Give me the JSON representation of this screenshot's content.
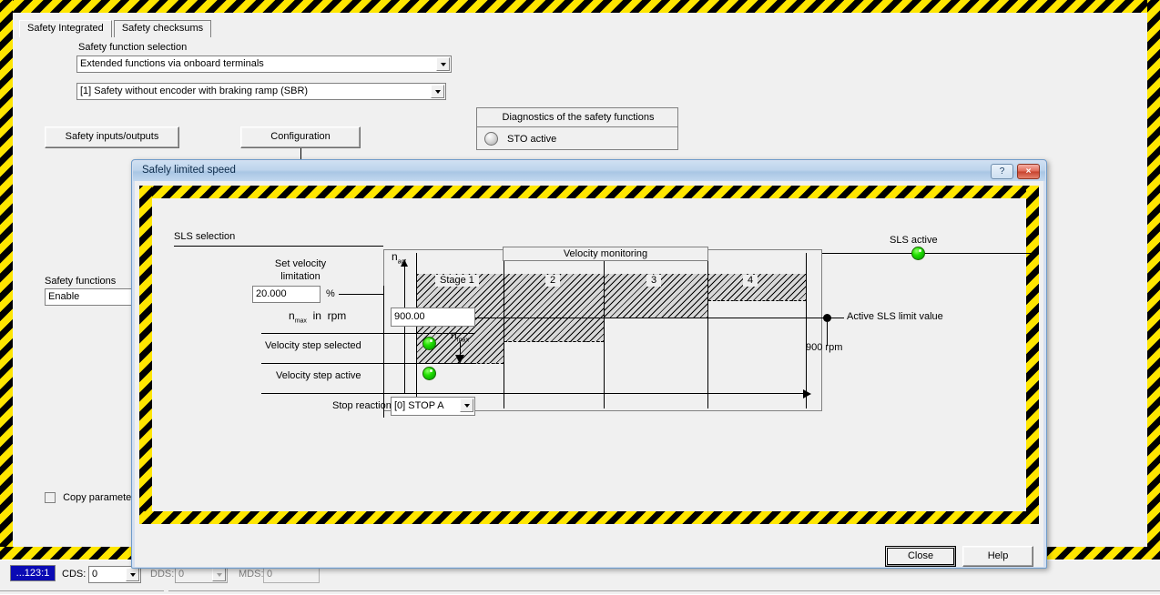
{
  "app": {
    "tabs": [
      {
        "label": "Safety Integrated",
        "active": true
      },
      {
        "label": "Safety checksums",
        "active": false
      }
    ],
    "safety_function_selection": {
      "title": "Safety function selection",
      "mode_combo": "Extended functions via onboard terminals",
      "variant_combo": "[1] Safety without encoder with braking ramp (SBR)"
    },
    "buttons": {
      "safety_io": "Safety inputs/outputs",
      "configuration": "Configuration"
    },
    "diagnostics": {
      "title": "Diagnostics of the safety functions",
      "items": [
        {
          "label": "STO active",
          "led": "gray"
        }
      ]
    },
    "safety_functions": {
      "title": "Safety functions",
      "value": "Enable"
    },
    "copy_parameter": {
      "label": "Copy parameter",
      "checked": false
    }
  },
  "statusbar": {
    "drive": "...123:1",
    "cds": {
      "label": "CDS:",
      "value": "0",
      "enabled": true
    },
    "dds": {
      "label": "DDS:",
      "value": "0",
      "enabled": false
    },
    "mds": {
      "label": "MDS:",
      "value": "0",
      "enabled": false
    }
  },
  "dialog": {
    "title": "Safely limited speed",
    "titlebar_buttons": {
      "help": "?",
      "close": "×"
    },
    "footer_buttons": {
      "close": "Close",
      "help": "Help"
    },
    "sls_selection_label": "SLS selection",
    "sls_active_label": "SLS active",
    "sls_active_led": "green",
    "active_limit_label": "Active SLS limit value",
    "active_limit_value": "900 rpm",
    "form": {
      "set_velocity_limitation_label_1": "Set velocity",
      "set_velocity_limitation_label_2": "limitation",
      "set_velocity_limitation_value": "20.000",
      "percent_unit": "%",
      "nmax_label_pre": "n",
      "nmax_label_sub": "max",
      "nmax_label_post": "in  rpm",
      "nmax_value": "900.00",
      "velocity_step_selected_label": "Velocity step selected",
      "velocity_step_selected_led": "green",
      "velocity_step_active_label": "Velocity step active",
      "velocity_step_active_led": "green",
      "stop_reaction_label": "Stop reaction",
      "stop_reaction_value": "[0] STOP A"
    }
  },
  "chart_data": {
    "type": "bar",
    "title": "Velocity monitoring",
    "ylabel": "n_act",
    "xlabel": "",
    "annotation": "n_max",
    "categories": [
      "Stage 1",
      "2",
      "3",
      "4"
    ],
    "values": [
      100,
      83,
      66,
      50
    ],
    "ylim": [
      0,
      118
    ],
    "grid": false,
    "legend": null,
    "notes": "Descending staircase of hatched velocity-monitoring stages; stage 1 is the tallest band, stage 4 the shortest."
  }
}
